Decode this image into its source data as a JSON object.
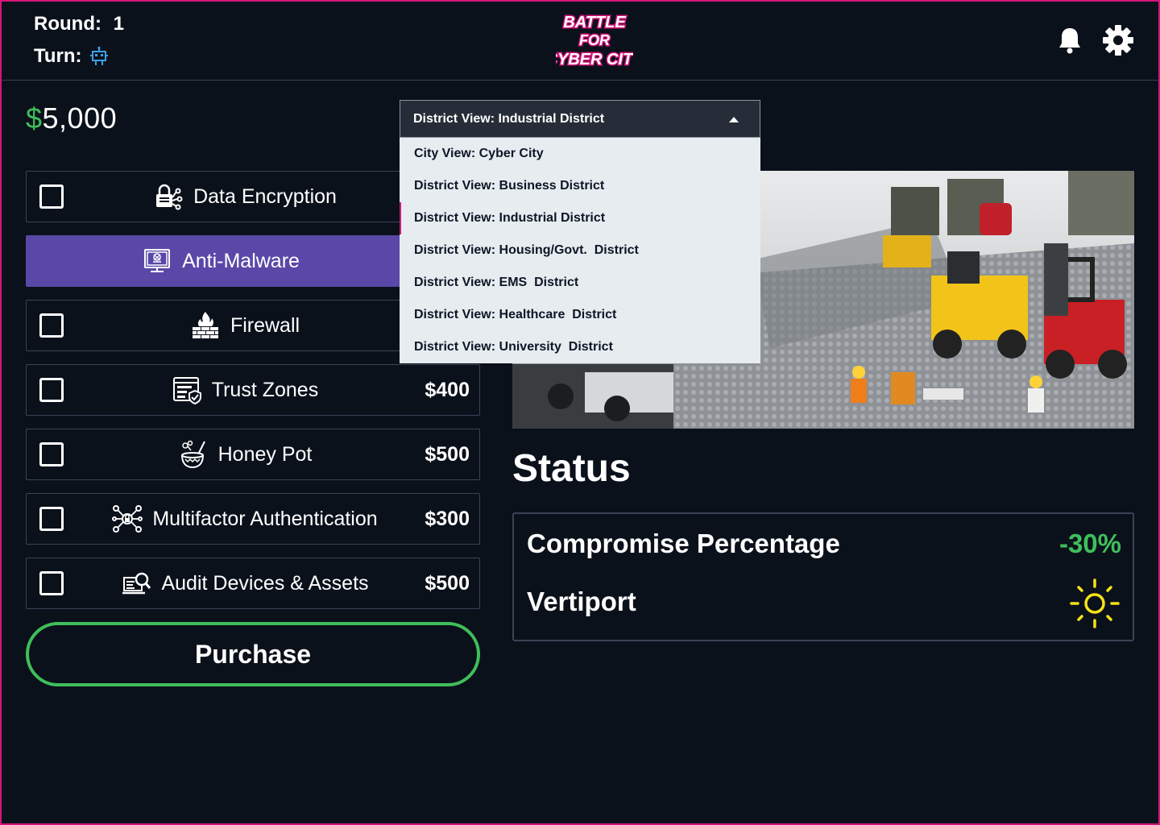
{
  "header": {
    "round_label": "Round:",
    "round_value": "1",
    "turn_label": "Turn:",
    "turn_icon": "robot-icon",
    "logo_lines": [
      "BATTLE",
      "FOR",
      "CYBER CITY"
    ],
    "notifications_icon": "bell-icon",
    "settings_icon": "gear-icon"
  },
  "budget": {
    "currency": "$",
    "amount": "5,000"
  },
  "defenses": [
    {
      "label": "Data Encryption",
      "icon": "encryption-lock-icon",
      "price": "",
      "checked": false
    },
    {
      "label": "Anti-Malware",
      "icon": "anti-malware-monitor-icon",
      "price": "",
      "selected": true
    },
    {
      "label": "Firewall",
      "icon": "firewall-icon",
      "price": "",
      "checked": false
    },
    {
      "label": "Trust Zones",
      "icon": "trust-zones-icon",
      "price": "$400",
      "checked": false
    },
    {
      "label": "Honey Pot",
      "icon": "honey-pot-icon",
      "price": "$500",
      "checked": false
    },
    {
      "label": "Multifactor Authentication",
      "icon": "multifactor-network-icon",
      "price": "$300",
      "checked": false
    },
    {
      "label": "Audit Devices & Assets",
      "icon": "audit-search-icon",
      "price": "$500",
      "checked": false
    }
  ],
  "purchase_label": "Purchase",
  "view_select": {
    "selected": "District View: Industrial District",
    "options": [
      "City View: Cyber City",
      "District View: Business District",
      "District View: Industrial District",
      "District View: Housing/Govt.  District",
      "District View: EMS  District",
      "District View: Healthcare  District",
      "District View: University  District"
    ]
  },
  "status": {
    "title": "Status",
    "compromise_label": "Compromise Percentage",
    "compromise_value": "-30%",
    "vertiport_label": "Vertiport",
    "vertiport_icon": "sun-icon"
  },
  "colors": {
    "accent_green": "#3fbf5a",
    "selected_purple": "#5a48a8",
    "frame_pink": "#d4157a",
    "sun_yellow": "#f5e11a"
  }
}
